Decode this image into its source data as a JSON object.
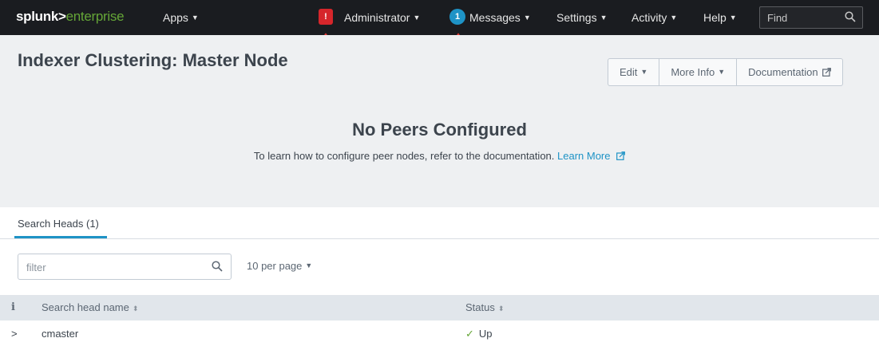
{
  "nav": {
    "logo_part1": "splunk>",
    "logo_part2": "enterprise",
    "apps": "Apps",
    "alert_badge": "!",
    "administrator": "Administrator",
    "messages_badge": "1",
    "messages": "Messages",
    "settings": "Settings",
    "activity": "Activity",
    "help": "Help",
    "find_placeholder": "Find"
  },
  "page": {
    "title": "Indexer Clustering: Master Node",
    "buttons": [
      "Edit",
      "More Info",
      "Documentation"
    ],
    "empty_title": "No Peers Configured",
    "empty_text": "To learn how to configure peer nodes, refer to the documentation.",
    "learn_more": "Learn More"
  },
  "tabs": {
    "search_heads": "Search Heads (1)"
  },
  "filter": {
    "placeholder": "filter",
    "per_page": "10 per page"
  },
  "table": {
    "info_col": "i",
    "columns": [
      "Search head name",
      "Status"
    ],
    "rows": [
      {
        "expand": ">",
        "name": "cmaster",
        "status": "Up"
      }
    ]
  },
  "colors": {
    "topbar": "#1a1c20",
    "brand_green": "#65a637",
    "alert_red": "#d6262b",
    "accent_blue": "#1e93c6",
    "annotation_arrow": "#e53935"
  }
}
